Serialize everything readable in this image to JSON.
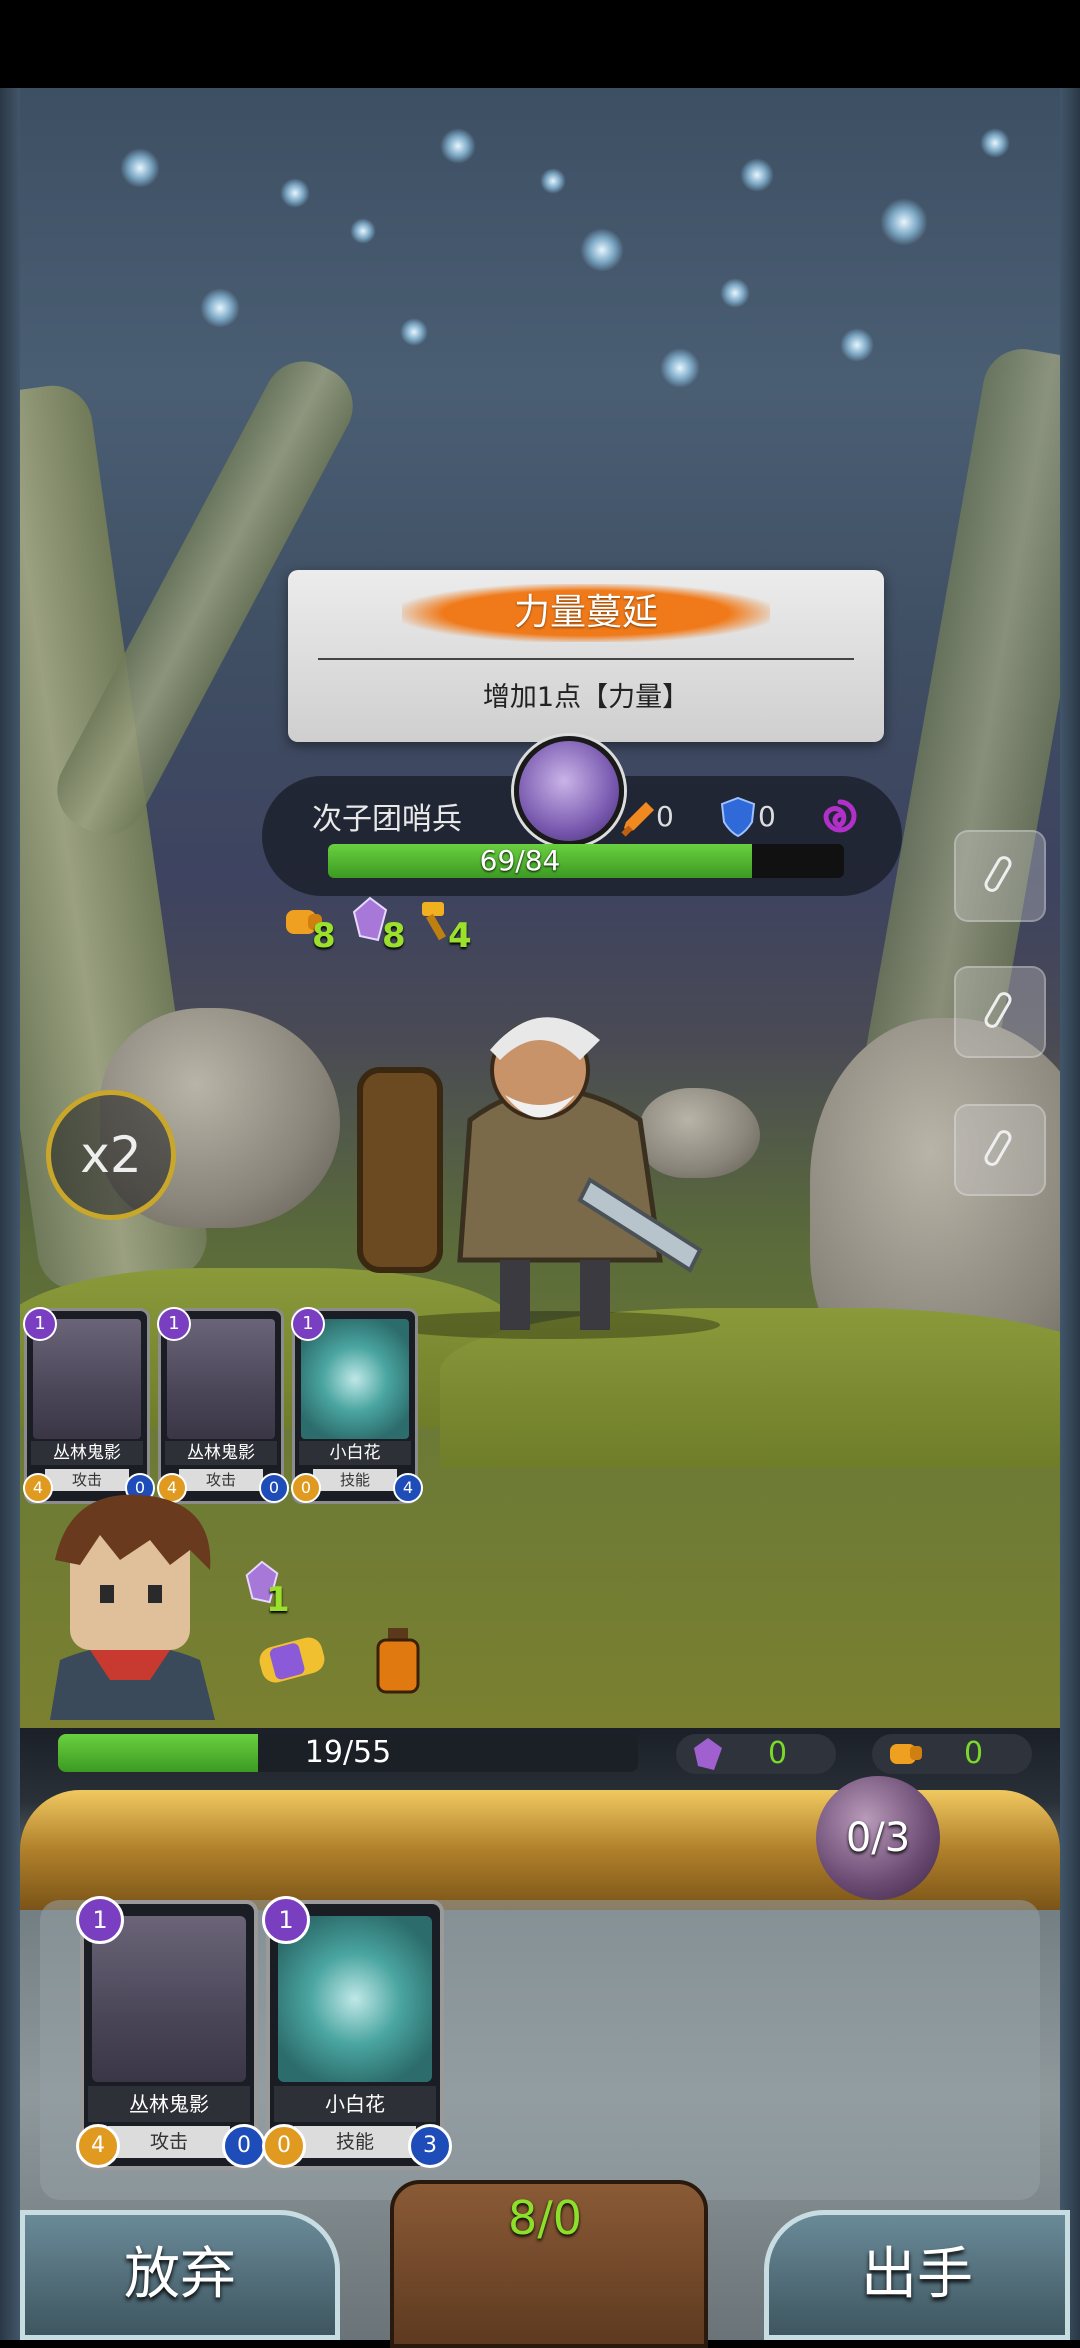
{
  "effect": {
    "title": "力量蔓延",
    "description": "增加1点【力量】"
  },
  "enemy": {
    "name": "次子团哨兵",
    "attack": "0",
    "defense": "0",
    "hp_current": 69,
    "hp_max": 84,
    "hp_text": "69/84",
    "buffs": [
      {
        "icon": "fist-icon",
        "value": "8"
      },
      {
        "icon": "crystal-icon",
        "value": "8"
      },
      {
        "icon": "hammer-icon",
        "value": "4"
      }
    ]
  },
  "speed": "x2",
  "draw_pile": [
    {
      "name": "丛林鬼影",
      "type": "攻击",
      "cost": "1",
      "left_badge": "4",
      "right_badge": "0",
      "art": "shadow"
    },
    {
      "name": "丛林鬼影",
      "type": "攻击",
      "cost": "1",
      "left_badge": "4",
      "right_badge": "0",
      "art": "shadow"
    },
    {
      "name": "小白花",
      "type": "技能",
      "cost": "1",
      "left_badge": "0",
      "right_badge": "4",
      "art": "flower"
    }
  ],
  "hero": {
    "buff_value": "1",
    "hp_current": 19,
    "hp_max": 55,
    "hp_text": "19/55",
    "stat_crystal": "0",
    "stat_fist": "0"
  },
  "energy": "0/3",
  "hand": [
    {
      "name": "丛林鬼影",
      "type": "攻击",
      "cost": "1",
      "left_badge": "4",
      "right_badge": "0",
      "art": "shadow"
    },
    {
      "name": "小白花",
      "type": "技能",
      "cost": "1",
      "left_badge": "0",
      "right_badge": "3",
      "art": "flower"
    }
  ],
  "deck_count": "8/0",
  "buttons": {
    "give_up": "放弃",
    "play": "出手"
  },
  "colors": {
    "hp_green": "#4cb82c",
    "buff_green": "#9be02a",
    "accent_orange": "#f07a1a",
    "energy_purple": "#6a4a72"
  }
}
